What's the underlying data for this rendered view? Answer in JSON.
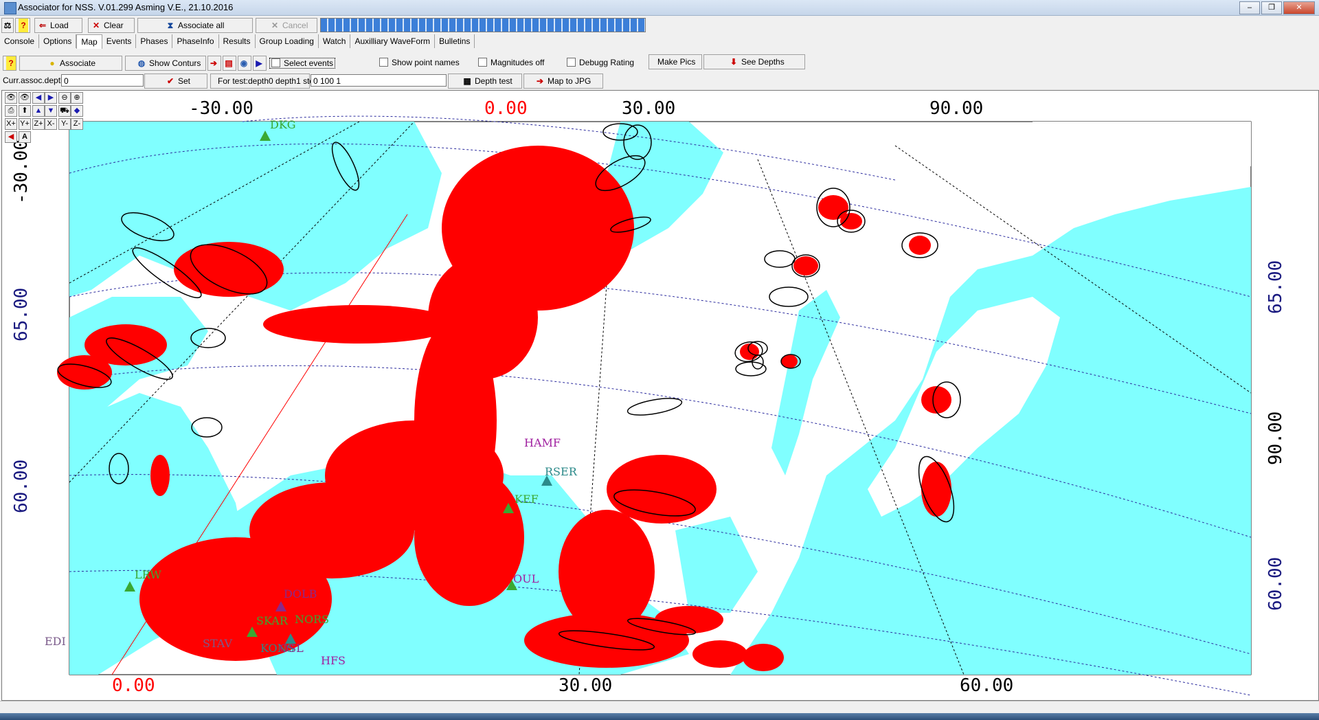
{
  "window": {
    "title": "Associator for NSS. V.01.299 Asming V.E., 21.10.2016"
  },
  "toolbar": {
    "load": "Load",
    "clear": "Clear",
    "associate_all": "Associate all",
    "cancel": "Cancel"
  },
  "tabs": [
    "Console",
    "Options",
    "Map",
    "Events",
    "Phases",
    "PhaseInfo",
    "Results",
    "Group Loading",
    "Watch",
    "Auxilliary WaveForm",
    "Bulletins"
  ],
  "map_toolbar": {
    "associate": "Associate",
    "show_conturs": "Show Conturs",
    "select_events": "Select events",
    "show_point_names": "Show point names",
    "magnitudes_off": "Magnitudes off",
    "debugg_rating": "Debugg Rating",
    "make_pics": "Make Pics",
    "see_depths": "See Depths"
  },
  "depth_row": {
    "curr_label": "Curr.assoc.depth",
    "curr_value": "0",
    "set": "Set",
    "test_label": "For test:depth0 depth1 step",
    "test_value": "0 100 1",
    "depth_test": "Depth test",
    "map_to_jpg": "Map to JPG"
  },
  "map": {
    "top_lon_labels": [
      "-30.00",
      "0.00",
      "30.00",
      "90.00"
    ],
    "bottom_lon_labels": [
      "0.00",
      "30.00",
      "60.00"
    ],
    "left_lat_labels": [
      "-30.00",
      "65.00",
      "60.00"
    ],
    "right_lat_labels": [
      "65.00",
      "90.00",
      "60.00"
    ],
    "stations": [
      "DKG",
      "HAMF",
      "KEF",
      "RSER",
      "OUL",
      "LRW",
      "DOLB",
      "SKAR",
      "NORS",
      "KONS",
      "OSL",
      "HFS",
      "EDI",
      "STAV"
    ],
    "colors": {
      "sea": "#80ffff",
      "land": "#ffffff",
      "event": "#ff0000",
      "ellipse": "#000000",
      "grid": "#2b2b9e"
    }
  },
  "mini_tools": [
    "X+",
    "Y+",
    "Z+",
    "X-",
    "Y-",
    "Z-"
  ]
}
